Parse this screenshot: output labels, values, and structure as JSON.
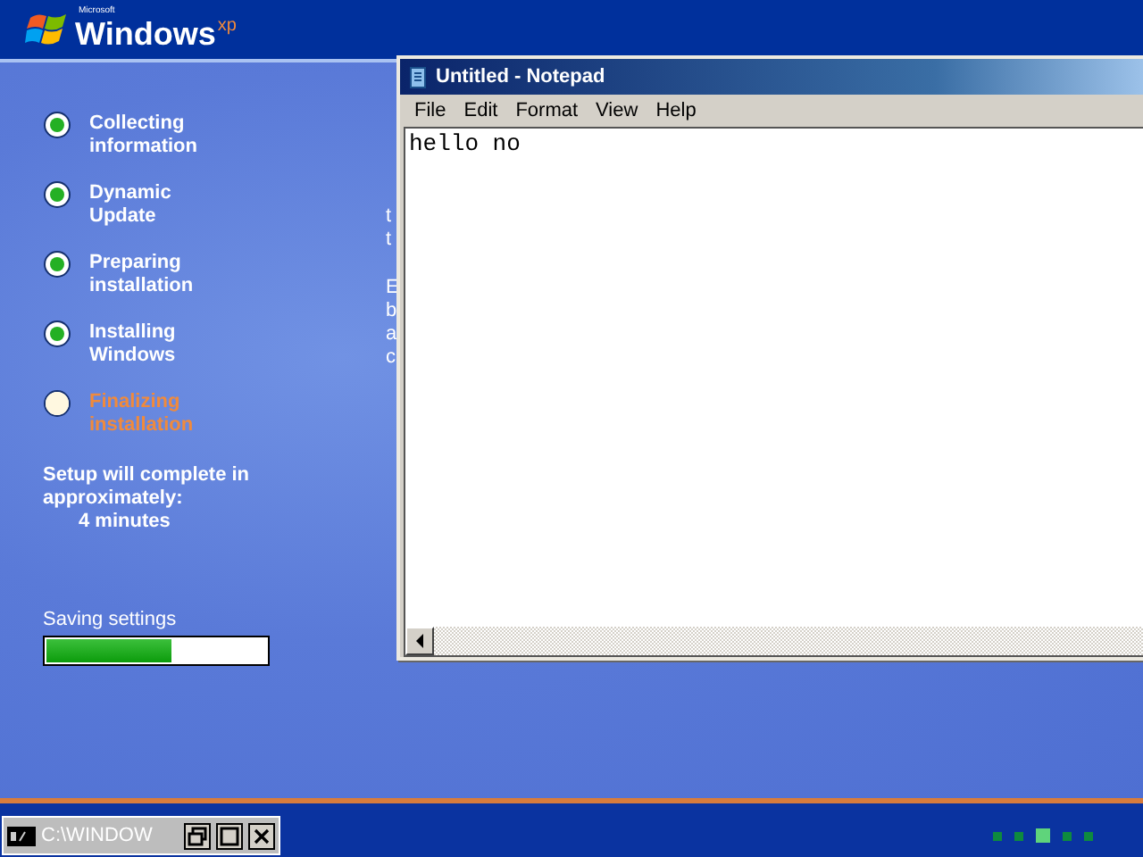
{
  "logo": {
    "maker": "Microsoft",
    "name": "Windows",
    "suffix": "xp"
  },
  "steps": [
    {
      "label": "Collecting information",
      "done": true
    },
    {
      "label": "Dynamic Update",
      "done": true
    },
    {
      "label": "Preparing installation",
      "done": true
    },
    {
      "label": "Installing Windows",
      "done": true
    },
    {
      "label": "Finalizing installation",
      "done": false
    }
  ],
  "estimate": {
    "text": "Setup will complete in approximately:",
    "time": "4 minutes"
  },
  "progress": {
    "label": "Saving settings",
    "level": 0.57
  },
  "content": {
    "paragraphs": [
      [
        "t",
        "t"
      ],
      [
        "E",
        "b",
        "a",
        "c"
      ]
    ]
  },
  "notepad": {
    "title": "Untitled - Notepad",
    "menu": [
      "File",
      "Edit",
      "Format",
      "View",
      "Help"
    ],
    "text": "hello no"
  },
  "taskbar": {
    "button": "C:\\WINDOW"
  },
  "dots": [
    {
      "selected": false
    },
    {
      "selected": false
    },
    {
      "selected": true
    },
    {
      "selected": false
    },
    {
      "selected": false
    }
  ]
}
